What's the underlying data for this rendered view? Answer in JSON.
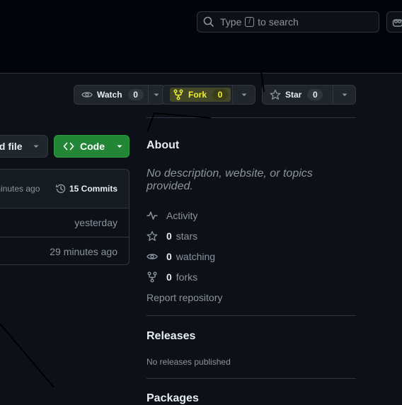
{
  "header": {
    "search": {
      "prefix": "Type",
      "key": "/",
      "suffix": "to search"
    }
  },
  "repo_actions": {
    "watch": {
      "label": "Watch",
      "count": "0"
    },
    "fork": {
      "label": "Fork",
      "count": "0",
      "highlight_color": "#f2ee2f"
    },
    "star": {
      "label": "Star",
      "count": "0"
    }
  },
  "code_toolbar": {
    "add_file_label": "ld file",
    "code_label": "Code",
    "code_color": "#238636"
  },
  "files": {
    "latest_time": "minutes ago",
    "commits_label": "15 Commits",
    "rows": [
      {
        "time": "yesterday"
      },
      {
        "time": "29 minutes ago"
      }
    ]
  },
  "about": {
    "title": "About",
    "description": "No description, website, or topics provided.",
    "activity": "Activity",
    "stars_count": "0",
    "stars_label": "stars",
    "watching_count": "0",
    "watching_label": "watching",
    "forks_count": "0",
    "forks_label": "forks",
    "report": "Report repository"
  },
  "releases": {
    "title": "Releases",
    "empty": "No releases published"
  },
  "packages": {
    "title": "Packages"
  },
  "icons": [
    "search-icon",
    "copilot-icon",
    "eye-icon",
    "fork-icon",
    "star-icon",
    "caret-down-icon",
    "code-icon",
    "history-icon",
    "pulse-icon"
  ]
}
